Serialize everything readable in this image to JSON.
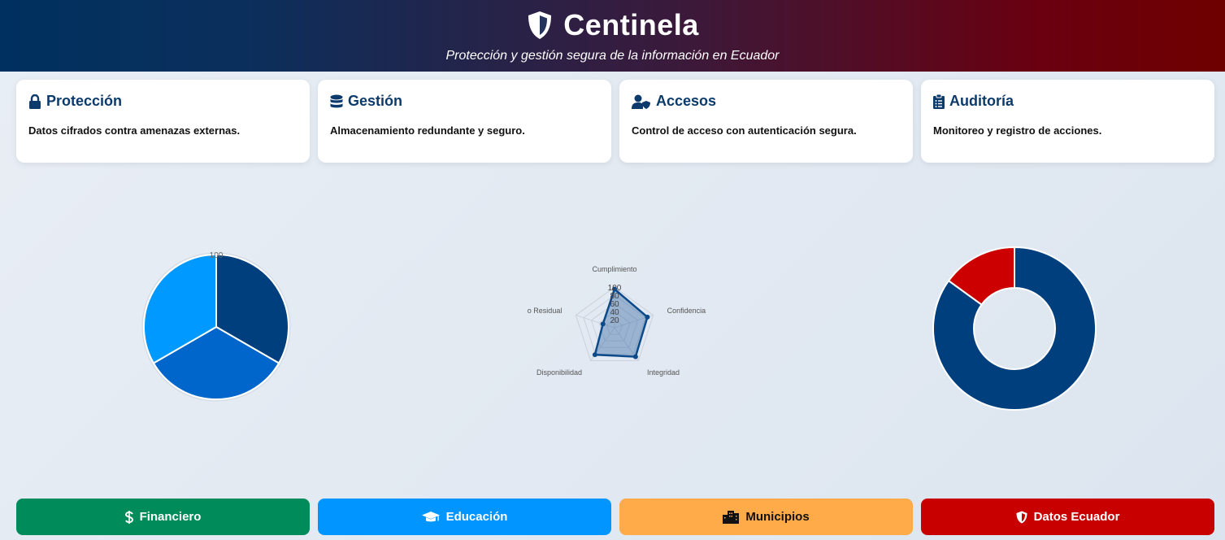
{
  "header": {
    "title": "Centinela",
    "tagline": "Protección y gestión segura de la información en Ecuador",
    "logo_icon": "shield-icon"
  },
  "cards": [
    {
      "title": "Protección",
      "icon": "lock-icon",
      "desc": "Datos cifrados contra amenazas externas."
    },
    {
      "title": "Gestión",
      "icon": "database-icon",
      "desc": "Almacenamiento redundante y seguro."
    },
    {
      "title": "Accesos",
      "icon": "user-shield-icon",
      "desc": "Control de acceso con autenticación segura."
    },
    {
      "title": "Auditoría",
      "icon": "clipboard-list-icon",
      "desc": "Monitoreo y registro de acciones."
    }
  ],
  "chart_data": [
    {
      "type": "polar-area",
      "scale_max": 100,
      "tick_label": "100",
      "values": [
        100,
        100,
        100
      ],
      "colors": [
        "#003f7d",
        "#0066cc",
        "#0099ff"
      ]
    },
    {
      "type": "radar",
      "categories": [
        "Cumplimiento",
        "Confidencia",
        "Integridad",
        "Disponibilidad",
        "o Residual"
      ],
      "values": [
        95,
        85,
        88,
        82,
        30
      ],
      "ticks": [
        "100",
        "80",
        "60",
        "40",
        "20"
      ],
      "range": [
        0,
        100
      ],
      "color": "#0c4a8a"
    },
    {
      "type": "doughnut",
      "values": [
        85,
        15
      ],
      "colors": [
        "#003f7d",
        "#cc0000"
      ]
    }
  ],
  "buttons": [
    {
      "label": "Financiero",
      "icon": "dollar-icon",
      "color": "#008c5a"
    },
    {
      "label": "Educación",
      "icon": "graduation-cap-icon",
      "color": "#0095ff"
    },
    {
      "label": "Municipios",
      "icon": "city-icon",
      "color": "#ffab4a"
    },
    {
      "label": "Datos Ecuador",
      "icon": "shield-icon",
      "color": "#c90000"
    }
  ]
}
